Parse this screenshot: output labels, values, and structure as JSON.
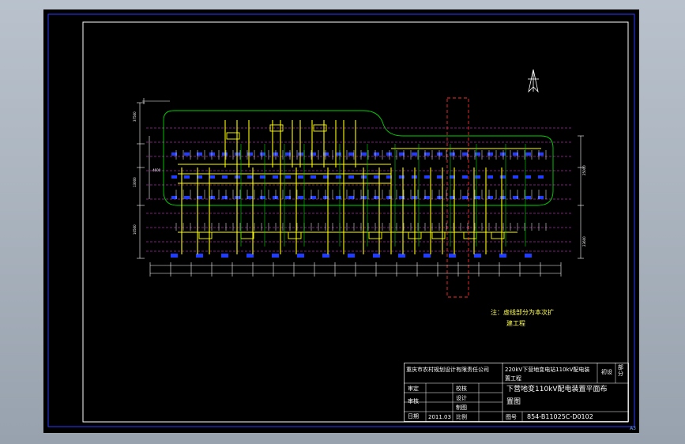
{
  "notes": {
    "line1": "注：虚线部分为本次扩",
    "line2": "建工程"
  },
  "title_block": {
    "company": "重庆市农村规划设计有限责任公司",
    "project": "220kV下营地变电站110kV配电装置工程",
    "stage_label": "初设",
    "stage_value": "部分",
    "drawing_title_line1": "下营地变110kV配电装置平面布",
    "drawing_title_line2": "置图",
    "row_labels": {
      "approve": "审定",
      "review": "审核",
      "check": "校核",
      "design": "设计",
      "draw": "制图",
      "date": "日期",
      "scale": "比例",
      "drawing_no": "图号"
    },
    "date_value": "2011.03",
    "drawing_number": "854-B11025C-D0102"
  },
  "sheet_size": "A3",
  "colors": {
    "bus": "#ffff00",
    "equipment": "#1f3cff",
    "boundary": "#00d400",
    "axis": "#ff3cff",
    "extension": "#ff2a2a",
    "dimension": "#ffffff",
    "border": "#2a3cff"
  }
}
